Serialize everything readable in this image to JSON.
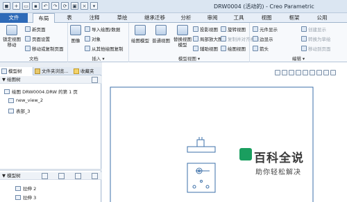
{
  "window": {
    "title": "DRW0004 (活动的) - Creo Parametric"
  },
  "ribbon_tabs": [
    {
      "label": "文件"
    },
    {
      "label": "布局"
    },
    {
      "label": "表"
    },
    {
      "label": "注释"
    },
    {
      "label": "草绘"
    },
    {
      "label": "继承迁移"
    },
    {
      "label": "分析"
    },
    {
      "label": "审阅"
    },
    {
      "label": "工具"
    },
    {
      "label": "视图"
    },
    {
      "label": "框架"
    },
    {
      "label": "公用"
    }
  ],
  "ribbon": {
    "document": {
      "label": "文档",
      "lock_view_move": "锁定视图移动",
      "new_page": "新页面",
      "page_setup": "页面设置",
      "move_copy_page": "移动或复制页面"
    },
    "insert": {
      "label": "插入",
      "image": "图像",
      "import_drawing_data": "导入绘图/数据",
      "object": "对象",
      "copy_from_other_drawing": "从其他绘图复制"
    },
    "model_views": {
      "label": "模型视图",
      "drawing_model": "绘图模型",
      "general_view": "普通视图",
      "replace_view_model": "替换视图模型",
      "projection_view": "投影视图",
      "detail_view": "局部放大图",
      "auxiliary_view": "辅助视图",
      "rotated_view": "旋转视图",
      "copy_align_view": "复制并对齐视图",
      "drawing_view": "绘图视图"
    },
    "edit": {
      "label": "编辑",
      "element_display": "元件显示",
      "edge_display": "边显示",
      "arrow": "箭头",
      "create_display": "创建显示",
      "convert_to_draft": "转换为草绘",
      "move_to_page": "移动到页面"
    }
  },
  "left_panel": {
    "tabs": [
      {
        "label": "模型树"
      },
      {
        "label": "文件夹浏览..."
      },
      {
        "label": "收藏夹"
      }
    ],
    "drawing_tree": {
      "header": "绘图树",
      "items": [
        {
          "label": "绘图 DRW0004.DRW 的第 1 页"
        },
        {
          "label": "new_view_2"
        },
        {
          "label": "表部_3"
        }
      ]
    },
    "model_tree": {
      "header": "模型树",
      "items": [
        {
          "label": "拉伸 2"
        },
        {
          "label": "拉伸 3"
        }
      ]
    }
  },
  "watermark": {
    "title": "百科全说",
    "subtitle": "助你轻松解决"
  },
  "colors": {
    "file_tab": "#2d6ab8",
    "accent_line": "#3b6fa8",
    "watermark_green": "#1a9e5f"
  }
}
